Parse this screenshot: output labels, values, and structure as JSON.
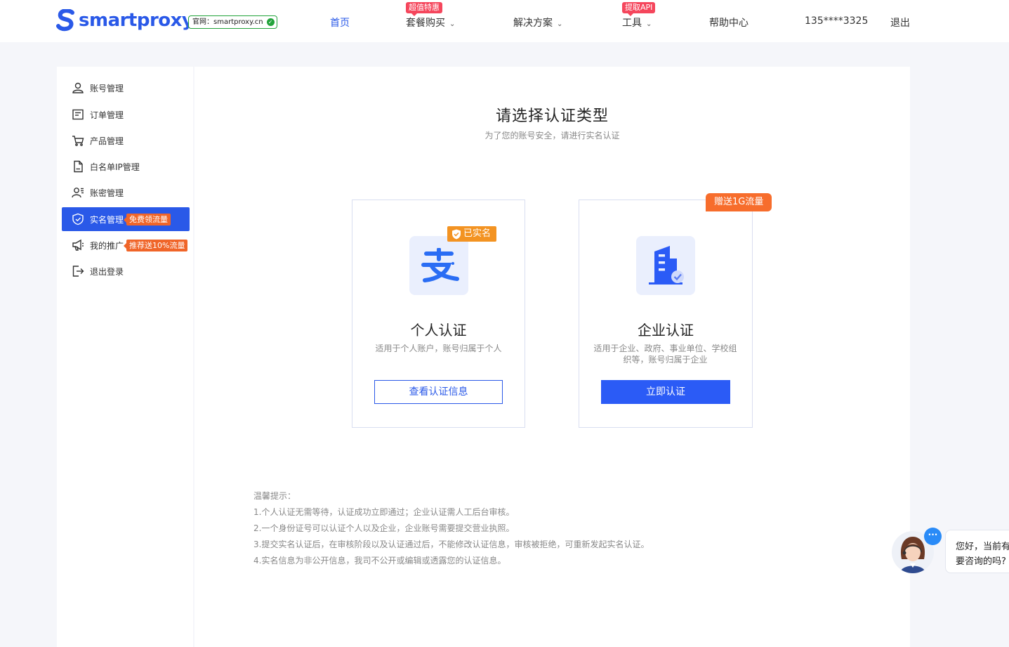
{
  "header": {
    "logo_text": "smartproxy",
    "site_badge": "官网：smartproxy.cn",
    "nav": [
      {
        "label": "首页",
        "active": true
      },
      {
        "label": "套餐购买",
        "badge": "超值特惠"
      },
      {
        "label": "解决方案"
      },
      {
        "label": "工具",
        "badge": "提取API"
      },
      {
        "label": "帮助中心"
      }
    ],
    "user_phone": "135****3325",
    "logout": "退出"
  },
  "sidebar": {
    "items": [
      {
        "label": "账号管理",
        "icon": "user-icon"
      },
      {
        "label": "订单管理",
        "icon": "order-icon"
      },
      {
        "label": "产品管理",
        "icon": "cart-icon"
      },
      {
        "label": "白名单IP管理",
        "icon": "file-icon"
      },
      {
        "label": "账密管理",
        "icon": "user-key-icon"
      },
      {
        "label": "实名管理",
        "icon": "shield-icon",
        "active": true,
        "tag": "免费领流量"
      },
      {
        "label": "我的推广",
        "icon": "megaphone-icon",
        "tag": "推荐送10%流量"
      },
      {
        "label": "退出登录",
        "icon": "logout-icon"
      }
    ]
  },
  "main": {
    "title": "请选择认证类型",
    "subtitle": "为了您的账号安全，请进行实名认证",
    "cards": [
      {
        "title": "个人认证",
        "desc": "适用于个人账户，账号归属于个人",
        "badge": "已实名",
        "button": "查看认证信息"
      },
      {
        "title": "企业认证",
        "desc": "适用于企业、政府、事业单位、学校组织等，账号归属于企业",
        "badge": "赠送1G流量",
        "button": "立即认证"
      }
    ],
    "tips": {
      "heading": "温馨提示：",
      "lines": [
        "1.个人认证无需等待，认证成功立即通过；企业认证需人工后台审核。",
        "2.一个身份证号可以认证个人以及企业，企业账号需要提交营业执照。",
        "3.提交实名认证后，在审核阶段以及认证通过后，不能修改认证信息，审核被拒绝，可重新发起实名认证。",
        "4.实名信息为非公开信息，我司不公开或编辑或透露您的认证信息。"
      ]
    }
  },
  "chat": {
    "line1": "您好，当前有",
    "line2": "要咨询的吗?"
  },
  "colors": {
    "primary": "#2a59e8",
    "orange": "#f06529",
    "badge_red": "#f5465c"
  }
}
